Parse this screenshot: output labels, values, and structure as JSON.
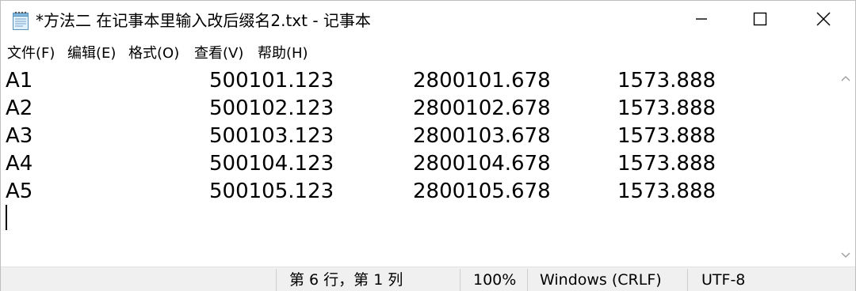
{
  "window": {
    "title": "*方法二 在记事本里输入改后缀名2.txt - 记事本"
  },
  "menu": {
    "items": [
      {
        "label": "文件(F)"
      },
      {
        "label": "编辑(E)"
      },
      {
        "label": "格式(O)"
      },
      {
        "label": "查看(V)"
      },
      {
        "label": "帮助(H)"
      }
    ]
  },
  "editor": {
    "lines": [
      [
        "A1",
        "500101.123",
        "2800101.678",
        "1573.888"
      ],
      [
        "A2",
        "500102.123",
        "2800102.678",
        "1573.888"
      ],
      [
        "A3",
        "500103.123",
        "2800103.678",
        "1573.888"
      ],
      [
        "A4",
        "500104.123",
        "2800104.678",
        "1573.888"
      ],
      [
        "A5",
        "500105.123",
        "2800105.678",
        "1573.888"
      ]
    ]
  },
  "status": {
    "position": "第 6 行，第 1 列",
    "zoom": "100%",
    "line_ending": "Windows (CRLF)",
    "encoding": "UTF-8"
  },
  "icons": {
    "app": "notepad-icon",
    "minimize": "minimize-icon",
    "maximize": "maximize-icon",
    "close": "close-icon",
    "scroll_up": "chevron-up-icon",
    "scroll_down": "chevron-down-icon"
  },
  "colors": {
    "statusbar_bg": "#f0f0f0",
    "text": "#000000"
  }
}
